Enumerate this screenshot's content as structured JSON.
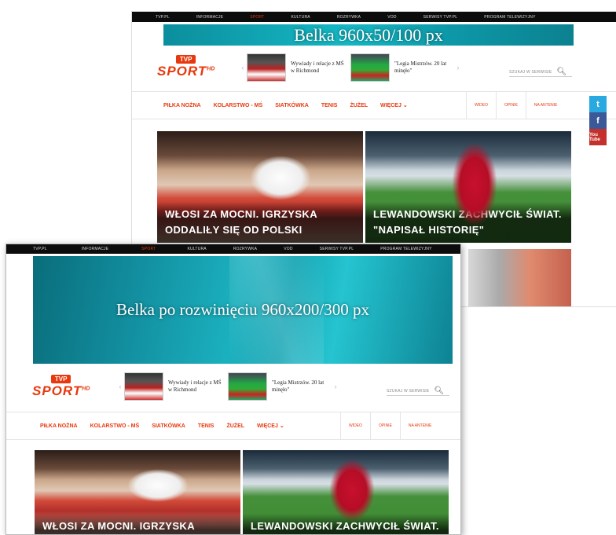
{
  "top_nav": [
    "TVP.PL",
    "INFORMACJE",
    "SPORT",
    "KULTURA",
    "ROZRYWKA",
    "VOD",
    "SERWISY TVP.PL",
    "PROGRAM TELEWIZYJNY"
  ],
  "banner_collapsed": "Belka 960x50/100 px",
  "banner_expanded": "Belka po rozwinięciu 960x200/300 px",
  "logo": {
    "tvp": "TVP",
    "sport": "SPORT",
    "hd": "HD"
  },
  "carousel": {
    "item1": "Wywiady i relacje z MŚ w Richmond",
    "item2": "\"Legia Mistrzów. 20 lat minęło\"",
    "prev": "‹",
    "next": "›"
  },
  "search": {
    "placeholder": "SZUKAJ W SERWISIE",
    "icon": "search-icon"
  },
  "menu": {
    "items": [
      "PIŁKA NOŻNA",
      "KOLARSTWO - MŚ",
      "SIATKÓWKA",
      "TENIS",
      "ŻUŻEL",
      "WIĘCEJ ⌄"
    ],
    "right": [
      "WIDEO",
      "OPINIE",
      "NA ANTENIE"
    ]
  },
  "cards": {
    "volley": "WŁOSI ZA MOCNI. IGRZYSKA ODDALIŁY SIĘ OD POLSKI",
    "football": "LEWANDOWSKI ZACHWYCIŁ ŚWIAT. \"NAPISAŁ HISTORIĘ\""
  },
  "social": {
    "twitter": "t",
    "facebook": "f",
    "youtube": "You Tube"
  },
  "colors": {
    "accent": "#e8380d",
    "banner": "#16b8c5",
    "twitter": "#2aa9e0",
    "facebook": "#3b5998",
    "youtube": "#c4302b"
  }
}
